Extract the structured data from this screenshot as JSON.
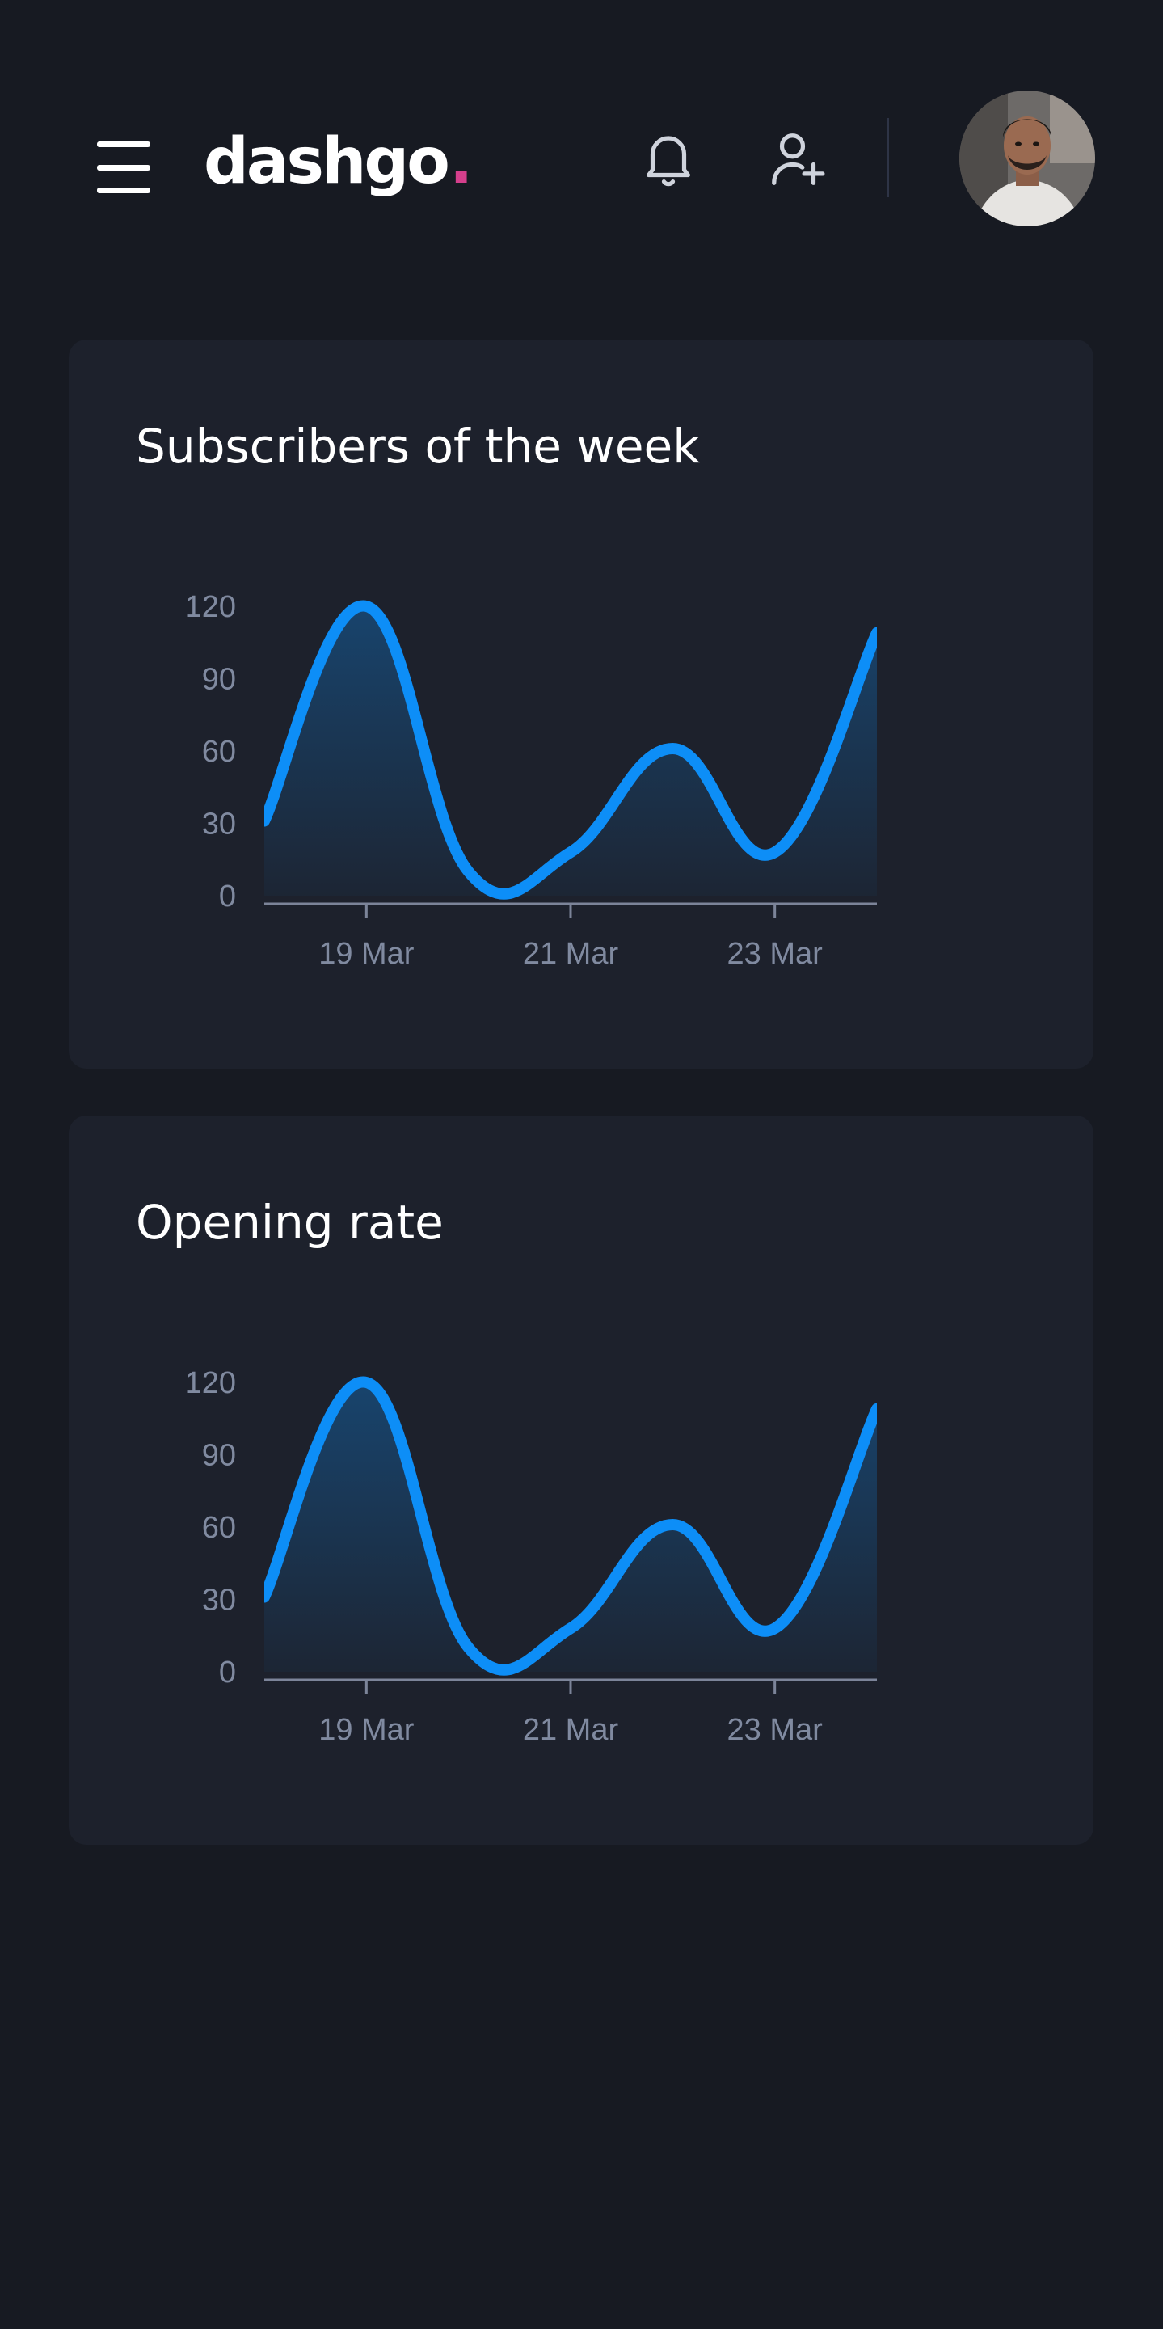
{
  "header": {
    "logo_text": "dashgo",
    "logo_dot": ".",
    "logo_dot_color": "#d53f8c",
    "menu_icon": "hamburger-menu-icon",
    "notification_icon": "bell-icon",
    "add_user_icon": "user-plus-icon",
    "avatar": "user-avatar-photo"
  },
  "colors": {
    "background": "#171a22",
    "card": "#1d212c",
    "line": "#0d8ef7",
    "axis": "#7c8499",
    "tick_text": "#808aa0"
  },
  "cards": [
    {
      "title": "Subscribers of the week"
    },
    {
      "title": "Opening rate"
    }
  ],
  "chart_data": [
    {
      "type": "area",
      "title": "Subscribers of the week",
      "x": [
        "2021-03-18",
        "2021-03-19",
        "2021-03-20",
        "2021-03-21",
        "2021-03-22",
        "2021-03-23",
        "2021-03-24"
      ],
      "series": [
        {
          "values": [
            31,
            120,
            10,
            18,
            61,
            18,
            109
          ]
        }
      ],
      "y_ticks": [
        0,
        30,
        60,
        90,
        120
      ],
      "x_ticks": [
        "19 Mar",
        "21 Mar",
        "23 Mar"
      ],
      "x_tick_positions": [
        1,
        3,
        5
      ],
      "ylim": [
        0,
        120
      ],
      "grid": false,
      "legend": "none",
      "xlabel": "",
      "ylabel": ""
    },
    {
      "type": "area",
      "title": "Opening rate",
      "x": [
        "2021-03-18",
        "2021-03-19",
        "2021-03-20",
        "2021-03-21",
        "2021-03-22",
        "2021-03-23",
        "2021-03-24"
      ],
      "series": [
        {
          "values": [
            31,
            120,
            10,
            18,
            61,
            18,
            109
          ]
        }
      ],
      "y_ticks": [
        0,
        30,
        60,
        90,
        120
      ],
      "x_ticks": [
        "19 Mar",
        "21 Mar",
        "23 Mar"
      ],
      "x_tick_positions": [
        1,
        3,
        5
      ],
      "ylim": [
        0,
        120
      ],
      "grid": false,
      "legend": "none",
      "xlabel": "",
      "ylabel": ""
    }
  ]
}
